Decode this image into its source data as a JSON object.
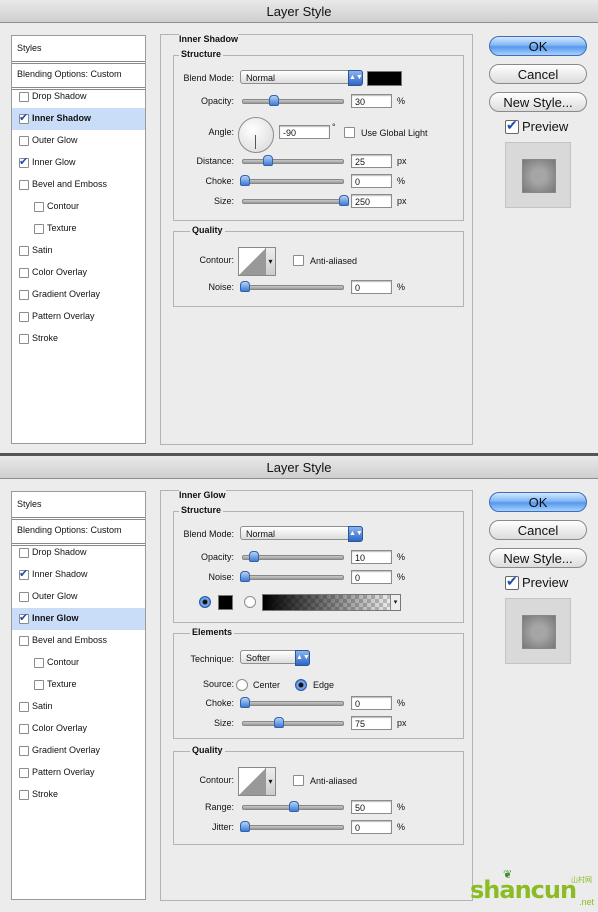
{
  "dialogs": [
    {
      "title": "Layer Style",
      "styles_header": "Styles",
      "blending_options": "Blending Options: Custom",
      "items": [
        {
          "label": "Drop Shadow",
          "checked": false,
          "selected": false,
          "indent": false
        },
        {
          "label": "Inner Shadow",
          "checked": true,
          "selected": true,
          "indent": false
        },
        {
          "label": "Outer Glow",
          "checked": false,
          "selected": false,
          "indent": false
        },
        {
          "label": "Inner Glow",
          "checked": true,
          "selected": false,
          "indent": false
        },
        {
          "label": "Bevel and Emboss",
          "checked": false,
          "selected": false,
          "indent": false
        },
        {
          "label": "Contour",
          "checked": false,
          "selected": false,
          "indent": true
        },
        {
          "label": "Texture",
          "checked": false,
          "selected": false,
          "indent": true
        },
        {
          "label": "Satin",
          "checked": false,
          "selected": false,
          "indent": false
        },
        {
          "label": "Color Overlay",
          "checked": false,
          "selected": false,
          "indent": false
        },
        {
          "label": "Gradient Overlay",
          "checked": false,
          "selected": false,
          "indent": false
        },
        {
          "label": "Pattern Overlay",
          "checked": false,
          "selected": false,
          "indent": false
        },
        {
          "label": "Stroke",
          "checked": false,
          "selected": false,
          "indent": false
        }
      ],
      "panel": {
        "section_title": "Inner Shadow",
        "structure_title": "Structure",
        "blend_mode_label": "Blend Mode:",
        "blend_mode_value": "Normal",
        "opacity_label": "Opacity:",
        "opacity_value": "30",
        "angle_label": "Angle:",
        "angle_value": "-90",
        "degree_symbol": "°",
        "use_global_light": "Use Global Light",
        "distance_label": "Distance:",
        "distance_value": "25",
        "choke_label": "Choke:",
        "choke_value": "0",
        "size_label": "Size:",
        "size_value": "250",
        "quality_title": "Quality",
        "contour_label": "Contour:",
        "anti_aliased": "Anti-aliased",
        "noise_label": "Noise:",
        "noise_value": "0",
        "unit_percent": "%",
        "unit_px": "px"
      },
      "buttons": {
        "ok": "OK",
        "cancel": "Cancel",
        "new_style": "New Style...",
        "preview": "Preview"
      }
    },
    {
      "title": "Layer Style",
      "styles_header": "Styles",
      "blending_options": "Blending Options: Custom",
      "items": [
        {
          "label": "Drop Shadow",
          "checked": false,
          "selected": false,
          "indent": false
        },
        {
          "label": "Inner Shadow",
          "checked": true,
          "selected": false,
          "indent": false
        },
        {
          "label": "Outer Glow",
          "checked": false,
          "selected": false,
          "indent": false
        },
        {
          "label": "Inner Glow",
          "checked": true,
          "selected": true,
          "indent": false
        },
        {
          "label": "Bevel and Emboss",
          "checked": false,
          "selected": false,
          "indent": false
        },
        {
          "label": "Contour",
          "checked": false,
          "selected": false,
          "indent": true
        },
        {
          "label": "Texture",
          "checked": false,
          "selected": false,
          "indent": true
        },
        {
          "label": "Satin",
          "checked": false,
          "selected": false,
          "indent": false
        },
        {
          "label": "Color Overlay",
          "checked": false,
          "selected": false,
          "indent": false
        },
        {
          "label": "Gradient Overlay",
          "checked": false,
          "selected": false,
          "indent": false
        },
        {
          "label": "Pattern Overlay",
          "checked": false,
          "selected": false,
          "indent": false
        },
        {
          "label": "Stroke",
          "checked": false,
          "selected": false,
          "indent": false
        }
      ],
      "panel": {
        "section_title": "Inner Glow",
        "structure_title": "Structure",
        "blend_mode_label": "Blend Mode:",
        "blend_mode_value": "Normal",
        "opacity_label": "Opacity:",
        "opacity_value": "10",
        "noise_label": "Noise:",
        "noise_value": "0",
        "elements_title": "Elements",
        "technique_label": "Technique:",
        "technique_value": "Softer",
        "source_label": "Source:",
        "source_center": "Center",
        "source_edge": "Edge",
        "choke_label": "Choke:",
        "choke_value": "0",
        "size_label": "Size:",
        "size_value": "75",
        "quality_title": "Quality",
        "contour_label": "Contour:",
        "anti_aliased": "Anti-aliased",
        "range_label": "Range:",
        "range_value": "50",
        "jitter_label": "Jitter:",
        "jitter_value": "0",
        "unit_percent": "%",
        "unit_px": "px"
      },
      "buttons": {
        "ok": "OK",
        "cancel": "Cancel",
        "new_style": "New Style...",
        "preview": "Preview"
      }
    }
  ],
  "watermark": {
    "brand": "shancun",
    "small": "山村网",
    "tld": ".net"
  },
  "colors": {
    "accent": "#4f8fe8",
    "selection": "#c9ddf8",
    "watermark": "#8cbc24"
  }
}
